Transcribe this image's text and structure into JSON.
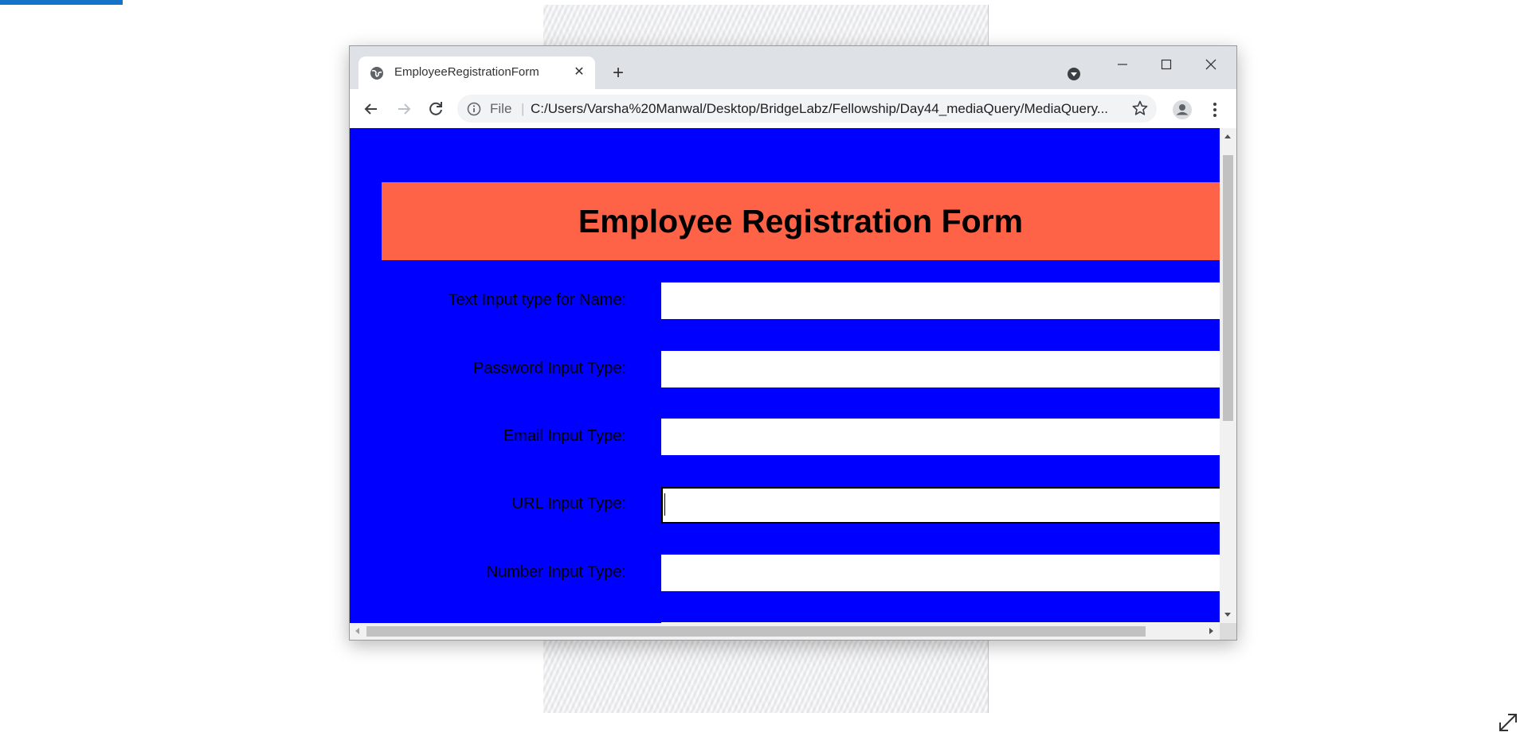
{
  "browser": {
    "tab": {
      "title": "EmployeeRegistrationForm",
      "close_glyph": "✕",
      "icon": "globe-icon"
    },
    "new_tab_glyph": "+",
    "window_controls": [
      "minimize-icon",
      "maximize-icon",
      "close-icon"
    ],
    "address_bar": {
      "scheme_label": "File",
      "separator": "|",
      "url": "C:/Users/Varsha%20Manwal/Desktop/BridgeLabz/Fellowship/Day44_mediaQuery/MediaQuery..."
    },
    "toolbar_icons": [
      "back-arrow-icon",
      "forward-arrow-icon",
      "reload-icon",
      "info-icon",
      "star-icon",
      "profile-icon",
      "more-vertical-icon"
    ]
  },
  "page": {
    "background_color": "#0000ff",
    "header": {
      "title": "Employee Registration Form",
      "background_color": "#ff6347"
    },
    "fields": [
      {
        "label": "Text Input type for Name:",
        "value": "",
        "focused": false
      },
      {
        "label": "Password Input Type:",
        "value": "",
        "focused": false
      },
      {
        "label": "Email Input Type:",
        "value": "",
        "focused": true,
        "note": ""
      },
      {
        "label": "URL Input Type:",
        "value": "",
        "focused": true
      },
      {
        "label": "Number Input Type:",
        "value": "",
        "focused": false
      }
    ]
  },
  "colors": {
    "accent": "#1473c9",
    "tab_strip": "#dee1e6",
    "omnibox": "#f1f3f4"
  }
}
